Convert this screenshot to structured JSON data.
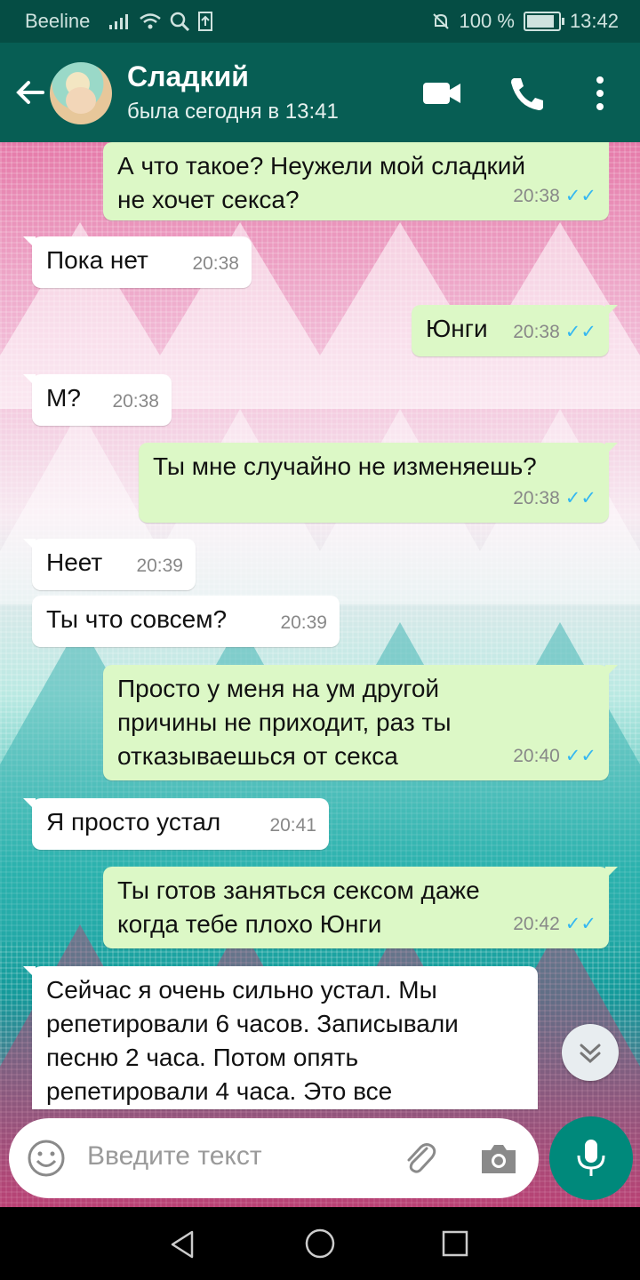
{
  "status_bar": {
    "carrier": "Beeline",
    "battery": "100 %",
    "battery_level": 1.0,
    "time": "13:42"
  },
  "header": {
    "contact_name": "Сладкий",
    "last_seen": "была сегодня в 13:41",
    "icons": [
      "back-arrow-icon",
      "video-call-icon",
      "phone-icon",
      "more-vert-icon"
    ]
  },
  "messages": [
    {
      "dir": "out",
      "text": "А что такое? Неужели мой сладкий\nне хочет секса?",
      "time": "20:38"
    },
    {
      "dir": "in",
      "text": "Пока нет",
      "time": "20:38"
    },
    {
      "dir": "out",
      "text": "Юнги",
      "time": "20:38"
    },
    {
      "dir": "in",
      "text": "М?",
      "time": "20:38"
    },
    {
      "dir": "out",
      "text": "Ты мне случайно не изменяешь?",
      "time": "20:38"
    },
    {
      "dir": "in",
      "text": "Неет",
      "time": "20:39"
    },
    {
      "dir": "in",
      "text": "Ты что совсем?",
      "time": "20:39"
    },
    {
      "dir": "out",
      "text": "Просто у меня на ум другой\nпричины не приходит, раз ты\nотказываешься от секса",
      "time": "20:40"
    },
    {
      "dir": "in",
      "text": "Я просто устал",
      "time": "20:41"
    },
    {
      "dir": "out",
      "text": "Ты готов заняться сексом даже\nкогда тебе плохо Юнги",
      "time": "20:42"
    },
    {
      "dir": "in",
      "text": "Сейчас я очень сильно устал. Мы\nрепетировали 6 часов. Записывали\nпесню 2 часа. Потом опять\nрепетировали 4 часа. Это все",
      "time": ""
    }
  ],
  "composer": {
    "placeholder": "Введите текст",
    "icons": [
      "emoji-icon",
      "attach-icon",
      "camera-icon",
      "mic-icon"
    ]
  },
  "colors": {
    "header": "#075e54",
    "status_bar": "#054d44",
    "outgoing_bubble": "#dcf8c6",
    "incoming_bubble": "#ffffff",
    "read_ticks": "#34b7f1",
    "mic_button": "#00897b"
  }
}
